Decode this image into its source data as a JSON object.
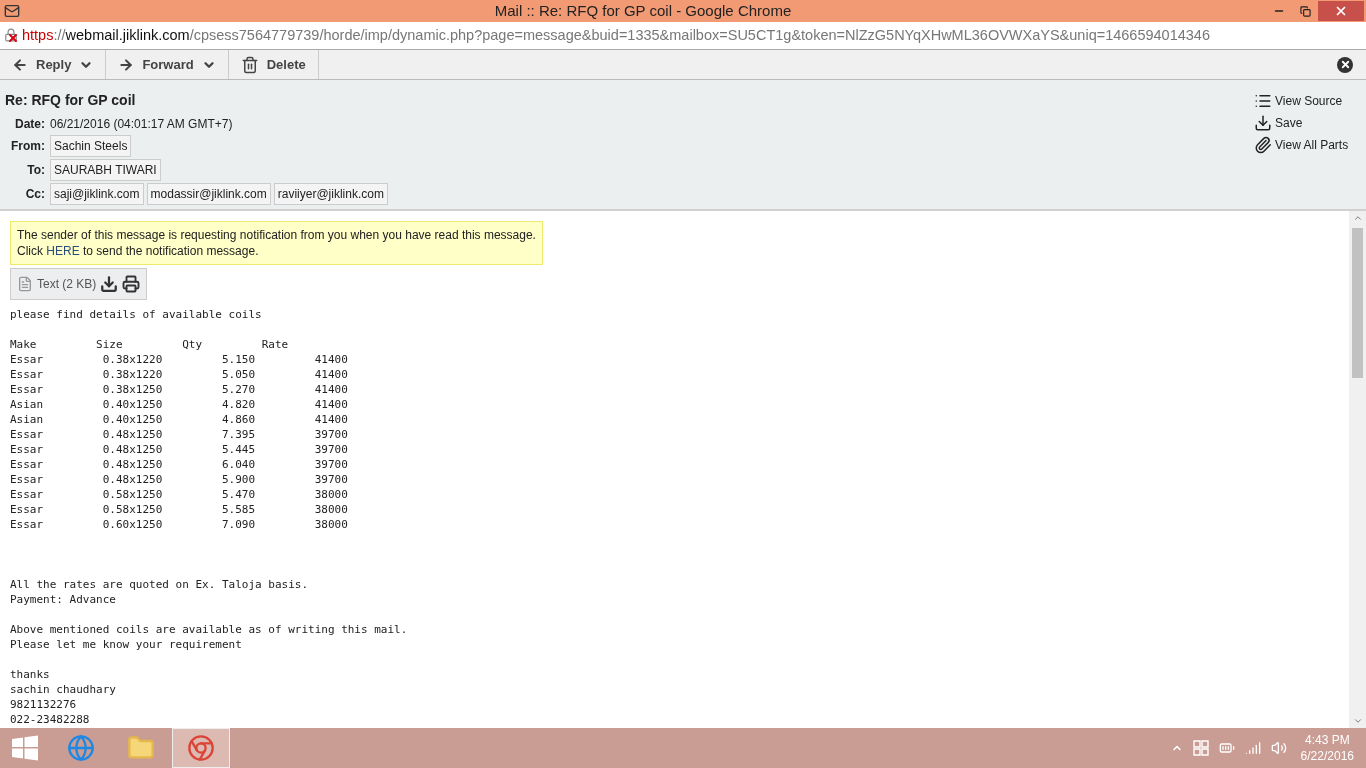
{
  "window": {
    "title": "Mail :: Re: RFQ for GP coil - Google Chrome"
  },
  "address_bar": {
    "scheme": "https",
    "separator": "://",
    "host": "webmail.jiklink.com",
    "path": "/cpsess7564779739/horde/imp/dynamic.php?page=message&buid=1335&mailbox=SU5CT1g&token=NlZzG5NYqXHwML36OVWXaYS&uniq=1466594014346",
    "insecure": true
  },
  "toolbar": [
    {
      "kind": "reply",
      "label": "Reply",
      "menu": true
    },
    {
      "kind": "forward",
      "label": "Forward",
      "menu": true
    },
    {
      "kind": "delete",
      "label": "Delete",
      "menu": false
    }
  ],
  "message": {
    "subject": "Re: RFQ for GP coil",
    "fields": [
      {
        "label": "Date:",
        "kind": "text",
        "values": [
          "06/21/2016 (04:01:17 AM GMT+7)"
        ]
      },
      {
        "label": "From:",
        "kind": "address",
        "values": [
          "Sachin Steels"
        ]
      },
      {
        "label": "To:",
        "kind": "address",
        "values": [
          "SAURABH TIWARI"
        ]
      },
      {
        "label": "Cc:",
        "kind": "address",
        "values": [
          "saji@jiklink.com",
          "modassir@jiklink.com",
          "raviiyer@jiklink.com"
        ]
      }
    ],
    "actions": [
      {
        "kind": "source",
        "label": "View Source"
      },
      {
        "kind": "save",
        "label": "Save"
      },
      {
        "kind": "parts",
        "label": "View All Parts"
      }
    ],
    "notice": {
      "line1": "The sender of this message is requesting notification from you when you have read this message.",
      "before": "Click",
      "link": "HERE",
      "after": "to send the notification message."
    },
    "attachment": {
      "label": "Text (2 KB)"
    },
    "body": [
      {
        "lines": [
          "please find details of available coils"
        ]
      },
      {
        "lines": [
          "Make         Size         Qty         Rate",
          "Essar         0.38x1220         5.150         41400",
          "Essar         0.38x1220         5.050         41400",
          "Essar         0.38x1250         5.270         41400",
          "Asian         0.40x1250         4.820         41400",
          "Asian         0.40x1250         4.860         41400",
          "Essar         0.48x1250         7.395         39700",
          "Essar         0.48x1250         5.445         39700",
          "Essar         0.48x1250         6.040         39700",
          "Essar         0.48x1250         5.900         39700",
          "Essar         0.58x1250         5.470         38000",
          "Essar         0.58x1250         5.585         38000",
          "Essar         0.60x1250         7.090         38000"
        ]
      },
      {
        "lines": [
          "All the rates are quoted on Ex. Taloja basis.",
          "Payment: Advance"
        ]
      },
      {
        "lines": [
          "Above mentioned coils are available as of writing this mail.",
          "Please let me know your requirement"
        ]
      },
      {
        "lines": [
          "thanks",
          "sachin chaudhary",
          "9821132276",
          "022-23482288"
        ]
      }
    ]
  },
  "taskbar": {
    "apps": [
      {
        "kind": "ie",
        "selected": false
      },
      {
        "kind": "explorer",
        "selected": false
      },
      {
        "kind": "chrome",
        "selected": true
      }
    ],
    "time": "4:43 PM",
    "date": "6/22/2016"
  }
}
